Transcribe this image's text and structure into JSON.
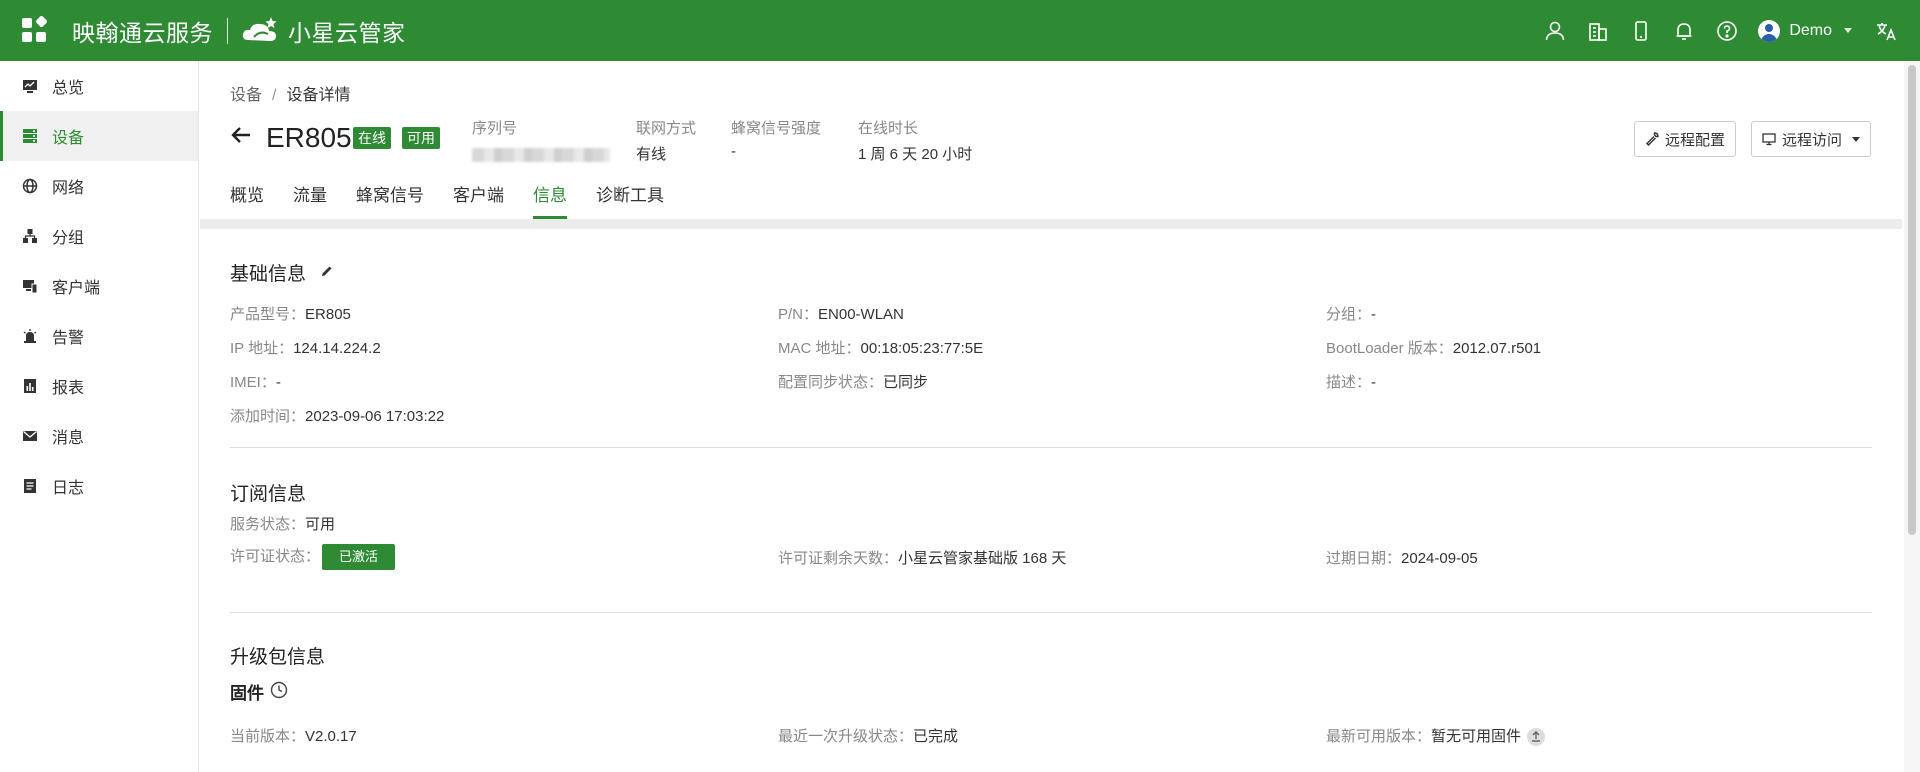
{
  "topbar": {
    "brand": "映翰通云服务",
    "product": "小星云管家",
    "user": "Demo",
    "colors": {
      "primary": "#2e8b34"
    },
    "icons": [
      "user-icon",
      "building-icon",
      "mobile-icon",
      "bell-icon",
      "help-icon",
      "translate-icon"
    ]
  },
  "sidebar": {
    "items": [
      {
        "label": "总览",
        "icon": "dashboard-icon"
      },
      {
        "label": "设备",
        "icon": "device-icon",
        "active": true
      },
      {
        "label": "网络",
        "icon": "globe-icon"
      },
      {
        "label": "分组",
        "icon": "group-icon"
      },
      {
        "label": "客户端",
        "icon": "client-icon"
      },
      {
        "label": "告警",
        "icon": "alarm-icon"
      },
      {
        "label": "报表",
        "icon": "report-icon"
      },
      {
        "label": "消息",
        "icon": "mail-icon"
      },
      {
        "label": "日志",
        "icon": "log-icon"
      }
    ]
  },
  "breadcrumb": {
    "parent": "设备",
    "current": "设备详情"
  },
  "device": {
    "name": "ER805",
    "badge_online": "在线",
    "badge_available": "可用",
    "serial_label": "序列号",
    "network_label": "联网方式",
    "network_value": "有线",
    "signal_label": "蜂窝信号强度",
    "signal_value": "-",
    "uptime_label": "在线时长",
    "uptime_value": "1 周 6 天 20 小时"
  },
  "actions": {
    "remote_config": "远程配置",
    "remote_access": "远程访问"
  },
  "tabs": [
    {
      "label": "概览"
    },
    {
      "label": "流量"
    },
    {
      "label": "蜂窝信号"
    },
    {
      "label": "客户端"
    },
    {
      "label": "信息",
      "active": true
    },
    {
      "label": "诊断工具"
    }
  ],
  "basic_info": {
    "title": "基础信息",
    "model_label": "产品型号：",
    "model": "ER805",
    "pn_label": "P/N：",
    "pn": "EN00-WLAN",
    "group_label": "分组：",
    "group": "-",
    "ip_label": "IP 地址：",
    "ip": "124.14.224.2",
    "mac_label": "MAC 地址：",
    "mac": "00:18:05:23:77:5E",
    "bootloader_label": "BootLoader 版本：",
    "bootloader": "2012.07.r501",
    "imei_label": "IMEI：",
    "imei": "-",
    "sync_label": "配置同步状态：",
    "sync": "已同步",
    "desc_label": "描述：",
    "desc": "-",
    "added_label": "添加时间：",
    "added": "2023-09-06 17:03:22"
  },
  "subscription": {
    "title": "订阅信息",
    "service_label": "服务状态：",
    "service": "可用",
    "license_label": "许可证状态：",
    "license": "已激活",
    "remaining_label": "许可证剩余天数：",
    "remaining": "小星云管家基础版 168 天",
    "expiry_label": "过期日期：",
    "expiry": "2024-09-05"
  },
  "upgrade": {
    "title": "升级包信息",
    "firmware_title": "固件",
    "current_label": "当前版本：",
    "current": "V2.0.17",
    "last_status_label": "最近一次升级状态：",
    "last_status": "已完成",
    "latest_label": "最新可用版本：",
    "latest": "暂无可用固件"
  }
}
